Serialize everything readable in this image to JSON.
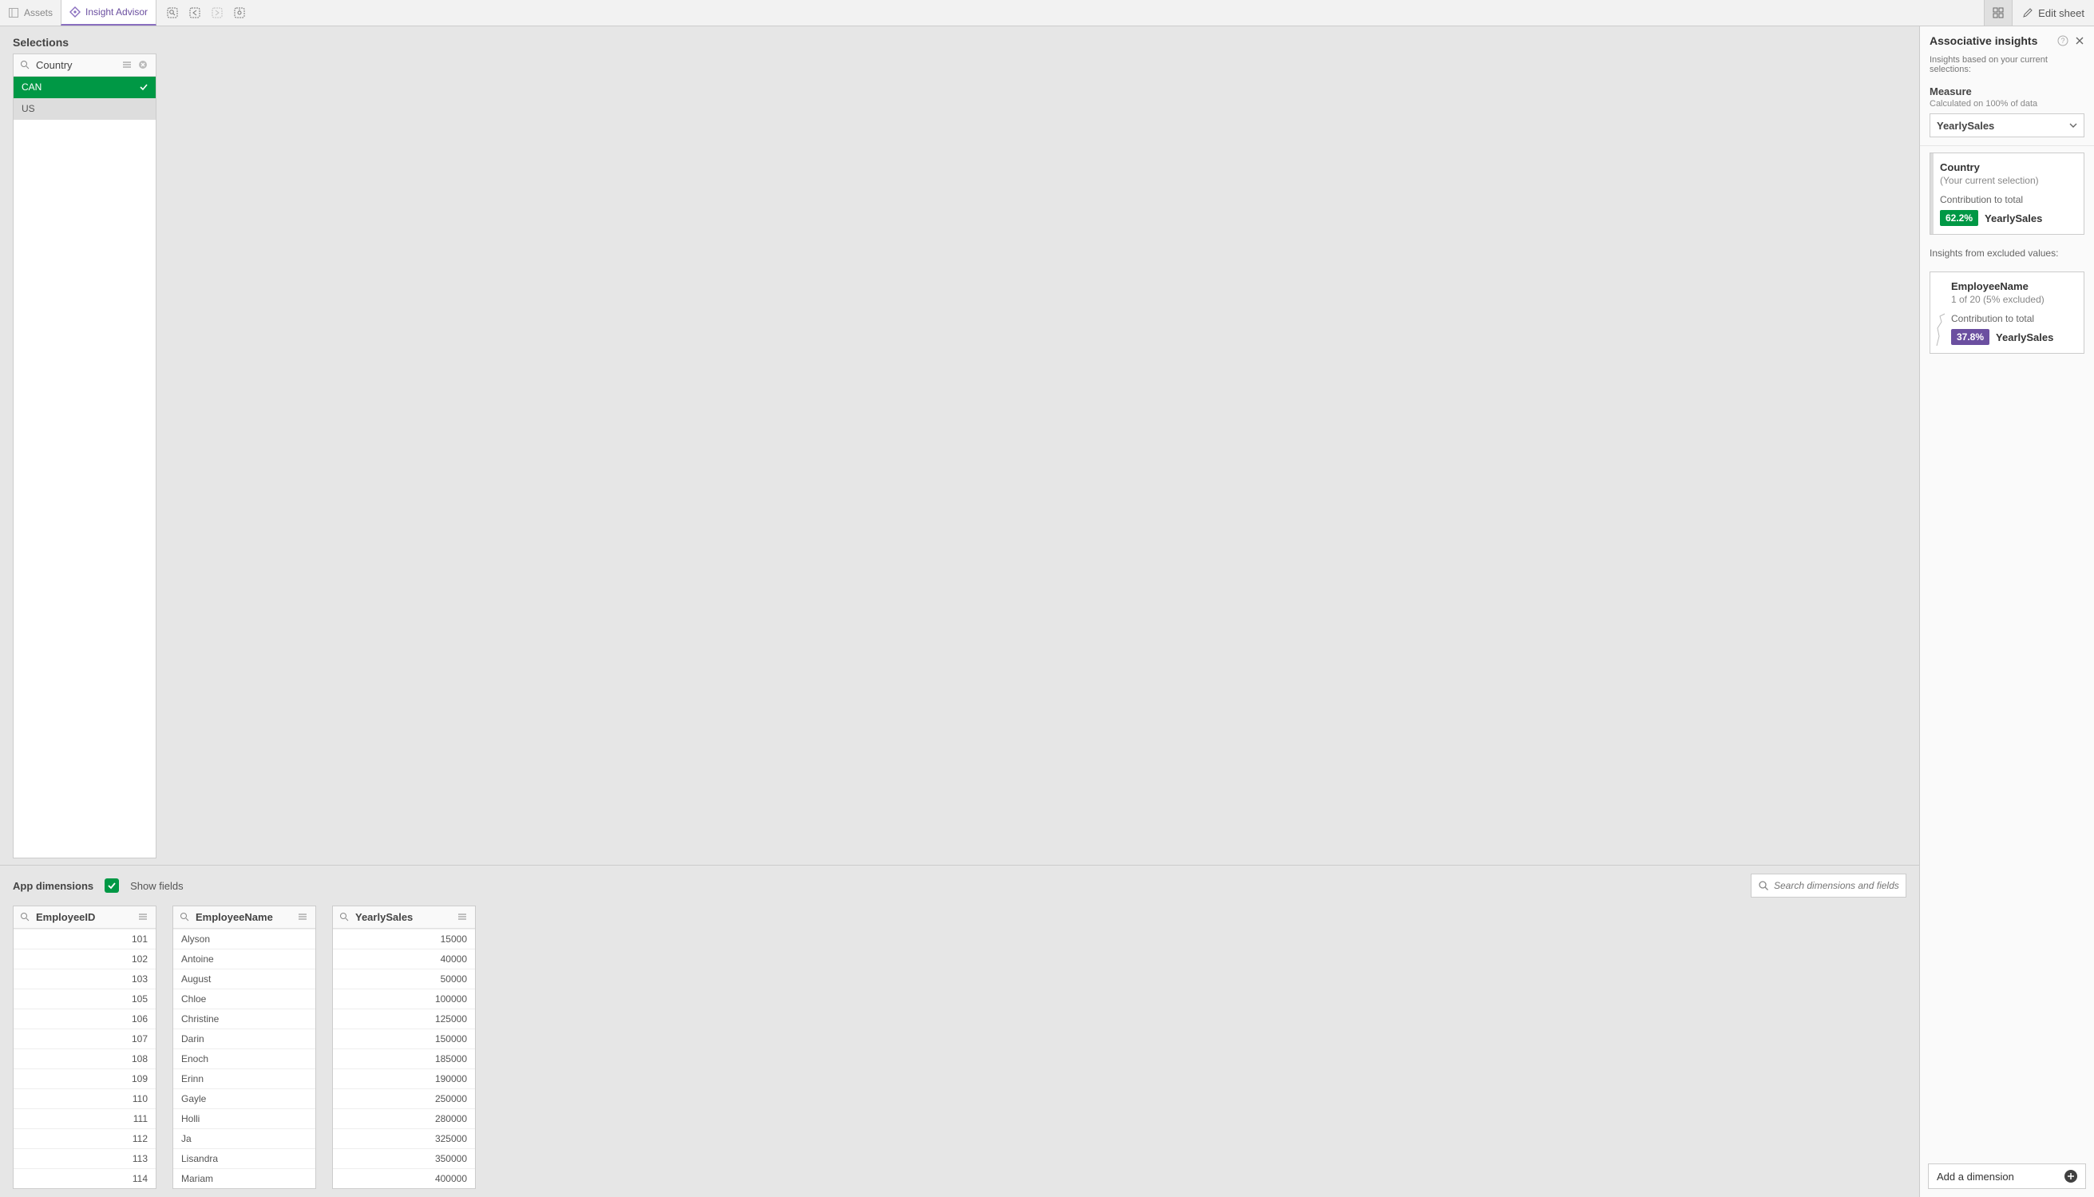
{
  "toolbar": {
    "assets": "Assets",
    "insight_advisor": "Insight Advisor",
    "edit_sheet": "Edit sheet"
  },
  "selections": {
    "title": "Selections",
    "filter": {
      "field": "Country",
      "values": [
        {
          "label": "CAN",
          "state": "selected"
        },
        {
          "label": "US",
          "state": "alternative"
        }
      ]
    }
  },
  "dimbar": {
    "title": "App dimensions",
    "show_fields": "Show fields",
    "search_placeholder": "Search dimensions and fields"
  },
  "fields": [
    {
      "name": "EmployeeID",
      "align": "right",
      "values": [
        "101",
        "102",
        "103",
        "105",
        "106",
        "107",
        "108",
        "109",
        "110",
        "111",
        "112",
        "113",
        "114"
      ]
    },
    {
      "name": "EmployeeName",
      "align": "left",
      "values": [
        "Alyson",
        "Antoine",
        "August",
        "Chloe",
        "Christine",
        "Darin",
        "Enoch",
        "Erinn",
        "Gayle",
        "Holli",
        "Ja",
        "Lisandra",
        "Mariam"
      ]
    },
    {
      "name": "YearlySales",
      "align": "right",
      "values": [
        "15000",
        "40000",
        "50000",
        "100000",
        "125000",
        "150000",
        "185000",
        "190000",
        "250000",
        "280000",
        "325000",
        "350000",
        "400000"
      ]
    }
  ],
  "insights": {
    "title": "Associative insights",
    "subtitle": "Insights based on your current selections:",
    "measure_label": "Measure",
    "measure_sub": "Calculated on 100% of data",
    "measure_value": "YearlySales",
    "card_selection": {
      "title": "Country",
      "sub": "(Your current selection)",
      "contrib_label": "Contribution to total",
      "pct": "62.2%",
      "measure": "YearlySales"
    },
    "excluded_label": "Insights from excluded values:",
    "card_excluded": {
      "title": "EmployeeName",
      "sub": "1 of 20 (5% excluded)",
      "contrib_label": "Contribution to total",
      "pct": "37.8%",
      "measure": "YearlySales"
    },
    "add_dim": "Add a dimension"
  }
}
